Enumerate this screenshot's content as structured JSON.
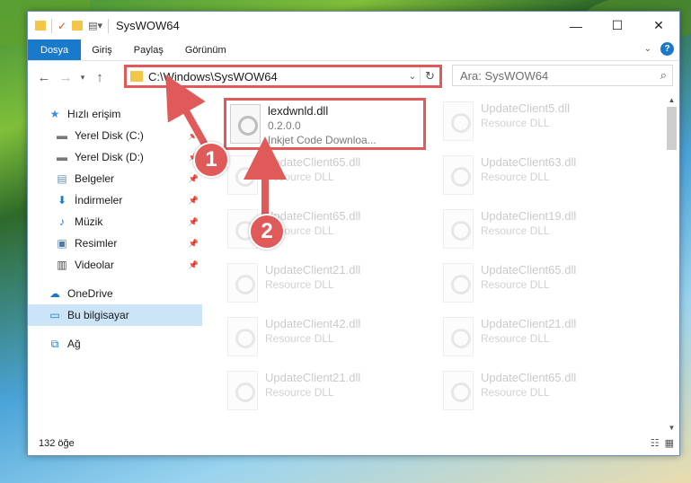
{
  "window": {
    "title": "SysWOW64",
    "minimize_glyph": "—",
    "maximize_glyph": "☐",
    "close_glyph": "✕"
  },
  "ribbon": {
    "tabs": [
      "Dosya",
      "Giriş",
      "Paylaş",
      "Görünüm"
    ]
  },
  "address": {
    "path": "C:\\Windows\\SysWOW64"
  },
  "search": {
    "placeholder": "Ara: SysWOW64"
  },
  "sidebar": {
    "items": [
      {
        "label": "Hızlı erişim",
        "icon": "star-icon",
        "pinned": false
      },
      {
        "label": "Yerel Disk (C:)",
        "icon": "drive-icon",
        "pinned": true
      },
      {
        "label": "Yerel Disk (D:)",
        "icon": "drive-icon",
        "pinned": true
      },
      {
        "label": "Belgeler",
        "icon": "documents-icon",
        "pinned": true
      },
      {
        "label": "İndirmeler",
        "icon": "download-icon",
        "pinned": true
      },
      {
        "label": "Müzik",
        "icon": "music-icon",
        "pinned": true
      },
      {
        "label": "Resimler",
        "icon": "pictures-icon",
        "pinned": true
      },
      {
        "label": "Videolar",
        "icon": "videos-icon",
        "pinned": true
      },
      {
        "label": "OneDrive",
        "icon": "cloud-icon",
        "pinned": false
      },
      {
        "label": "Bu bilgisayar",
        "icon": "computer-icon",
        "pinned": false
      },
      {
        "label": "Ağ",
        "icon": "network-icon",
        "pinned": false
      }
    ]
  },
  "files": [
    {
      "name": "lexdwnld.dll",
      "line2": "0.2.0.0",
      "line3": "Inkjet Code Downloa..."
    },
    {
      "name": "UpdateClient5.dll",
      "line2": "Resource DLL"
    },
    {
      "name": "UpdateClient65.dll",
      "line2": "Resource DLL"
    },
    {
      "name": "UpdateClient63.dll",
      "line2": "Resource DLL"
    },
    {
      "name": "UpdateClient65.dll",
      "line2": "Resource DLL"
    },
    {
      "name": "UpdateClient19.dll",
      "line2": "Resource DLL"
    },
    {
      "name": "UpdateClient21.dll",
      "line2": "Resource DLL"
    },
    {
      "name": "UpdateClient65.dll",
      "line2": "Resource DLL"
    },
    {
      "name": "UpdateClient42.dll",
      "line2": "Resource DLL"
    },
    {
      "name": "UpdateClient21.dll",
      "line2": "Resource DLL"
    },
    {
      "name": "UpdateClient21.dll",
      "line2": "Resource DLL"
    },
    {
      "name": "UpdateClient65.dll",
      "line2": "Resource DLL"
    }
  ],
  "status": {
    "item_count": "132 öğe"
  },
  "annotations": {
    "step1": "1",
    "step2": "2"
  },
  "colors": {
    "accent": "#1979ca",
    "highlight": "#e05a5a"
  }
}
